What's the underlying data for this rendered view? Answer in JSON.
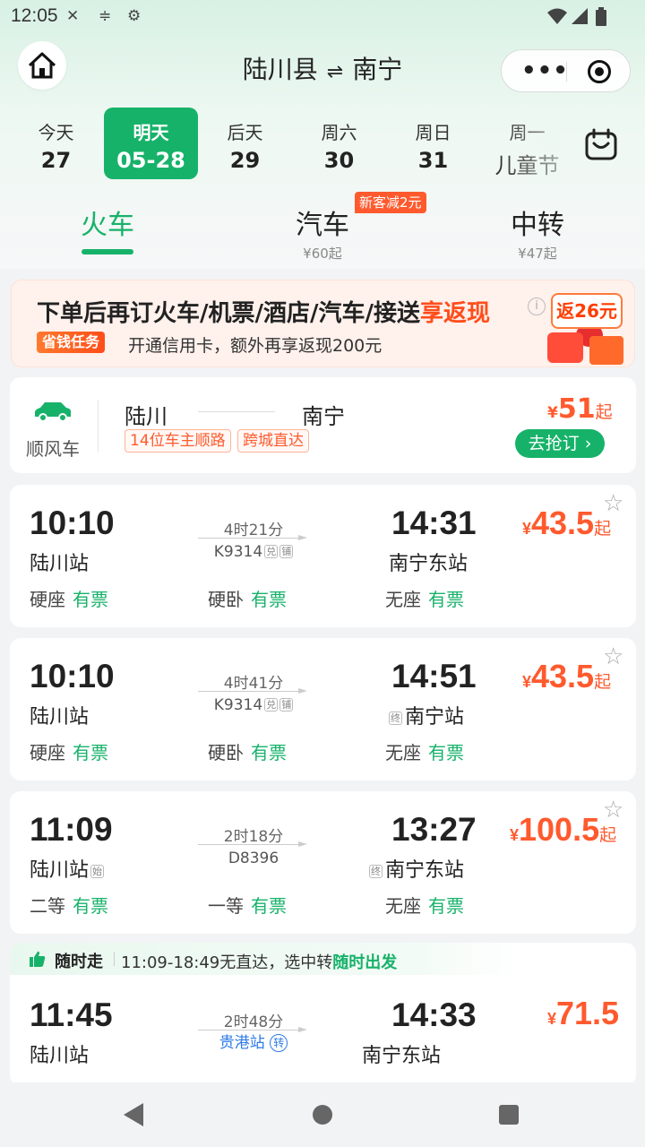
{
  "status_bar": {
    "time": "12:05",
    "icons": [
      "bandage-icon",
      "sliders-icon",
      "settings-gear-icon"
    ],
    "right_icons": [
      "wifi-icon",
      "signal-icon",
      "battery-icon"
    ]
  },
  "header": {
    "origin": "陆川县",
    "destination": "南宁",
    "swap_glyph": "⇌",
    "more_glyph": "•••"
  },
  "dates": [
    {
      "week": "今天",
      "day": "27"
    },
    {
      "week": "明天",
      "day": "05-28",
      "active": true
    },
    {
      "week": "后天",
      "day": "29"
    },
    {
      "week": "周六",
      "day": "30"
    },
    {
      "week": "周日",
      "day": "31"
    },
    {
      "week": "周一",
      "day": "儿童节"
    }
  ],
  "transport_tabs": [
    {
      "label": "火车",
      "sub": "",
      "active": true
    },
    {
      "label": "汽车",
      "sub": "¥60起",
      "badge": "新客减2元"
    },
    {
      "label": "中转",
      "sub": "¥47起"
    }
  ],
  "banner": {
    "headline_main": "下单后再订火车/机票/酒店/汽车/接送",
    "headline_highlight": "享返现",
    "info_glyph": "i",
    "task_tag": "省钱任务",
    "subline": "开通信用卡，额外再享返现200元",
    "reward": "返26元"
  },
  "ride_share": {
    "label": "顺风车",
    "from": "陆川",
    "to": "南宁",
    "tags": [
      "14位车主顺路",
      "跨城直达"
    ],
    "price_symbol": "¥",
    "price": "51",
    "price_suffix": "起",
    "button": "去抢订 ›"
  },
  "trains": [
    {
      "dep_time": "10:10",
      "dep_station": "陆川站",
      "dep_mark": "",
      "duration": "4时21分",
      "train_no": "K9314",
      "marks": [
        "兑",
        "铺"
      ],
      "arr_time": "14:31",
      "arr_station": "南宁东站",
      "arr_mark": "",
      "price_symbol": "¥",
      "price": "43.5",
      "price_suffix": "起",
      "seats": [
        {
          "name": "硬座",
          "status": "有票"
        },
        {
          "name": "硬卧",
          "status": "有票"
        },
        {
          "name": "无座",
          "status": "有票"
        }
      ]
    },
    {
      "dep_time": "10:10",
      "dep_station": "陆川站",
      "dep_mark": "",
      "duration": "4时41分",
      "train_no": "K9314",
      "marks": [
        "兑",
        "铺"
      ],
      "arr_time": "14:51",
      "arr_station": "南宁站",
      "arr_mark": "终",
      "price_symbol": "¥",
      "price": "43.5",
      "price_suffix": "起",
      "seats": [
        {
          "name": "硬座",
          "status": "有票"
        },
        {
          "name": "硬卧",
          "status": "有票"
        },
        {
          "name": "无座",
          "status": "有票"
        }
      ]
    },
    {
      "dep_time": "11:09",
      "dep_station": "陆川站",
      "dep_mark": "始",
      "duration": "2时18分",
      "train_no": "D8396",
      "marks": [],
      "arr_time": "13:27",
      "arr_station": "南宁东站",
      "arr_mark": "终",
      "price_symbol": "¥",
      "price": "100.5",
      "price_suffix": "起",
      "seats": [
        {
          "name": "二等",
          "status": "有票"
        },
        {
          "name": "一等",
          "status": "有票"
        },
        {
          "name": "无座",
          "status": "有票"
        }
      ]
    }
  ],
  "anytime": {
    "title": "随时走",
    "desc_prefix": "11:09-18:49无直达，选中转",
    "desc_highlight": "随时出发",
    "dep_time": "11:45",
    "dep_station": "陆川站",
    "duration": "2时48分",
    "via_station": "贵港站",
    "via_mark": "转",
    "arr_time": "14:33",
    "arr_station": "南宁东站",
    "price_symbol": "¥",
    "price": "71.5"
  },
  "colors": {
    "accent_green": "#17b26a",
    "price_orange": "#ff5a2e",
    "via_blue": "#2e7be6"
  }
}
